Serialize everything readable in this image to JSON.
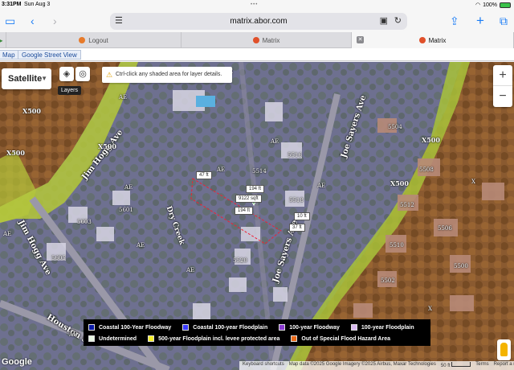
{
  "status": {
    "time": "3:31PM",
    "date": "Sun Aug 3",
    "battery": "100%"
  },
  "toolbar": {
    "url": "matrix.abor.com"
  },
  "tabs": [
    {
      "label": "Logout"
    },
    {
      "label": "Matrix"
    },
    {
      "label": "Matrix"
    }
  ],
  "map_types": {
    "map": "Map",
    "street_view": "Google Street View"
  },
  "map": {
    "type_select": "Satellite",
    "layers_tooltip": "Layers",
    "hint": "Ctrl-click any shaded area for layer details.",
    "zoom_in": "+",
    "zoom_out": "−",
    "streets": {
      "jim_hogg_1": "Jim Hogg Ave",
      "jim_hogg_2": "Jim Hogg Ave",
      "joe_sayers_1": "Joe Sayers Ave",
      "joe_sayers_2": "Joe Sayers Ave",
      "dry_creek": "Dry Creek",
      "houston": "Houston St"
    },
    "zones": {
      "x500": "X500",
      "ae": "AE",
      "x": "X"
    },
    "measurements": {
      "top": "47 ft",
      "right_top": "194 ft",
      "area": "9122 sqft",
      "bottom": "194 ft",
      "side_a": "10 ft",
      "side_b": "37 ft"
    },
    "house_numbers": [
      "5504",
      "5508",
      "5512",
      "5506",
      "5510",
      "5514",
      "5516",
      "5518",
      "5520",
      "5601",
      "5603",
      "5605",
      "5500",
      "5502"
    ],
    "attribution": {
      "keyboard": "Keyboard shortcuts",
      "data": "Map data ©2025 Google Imagery ©2025 Airbus, Maxar Technologies",
      "scale": "50 ft",
      "terms": "Terms",
      "report": "Report a map error"
    },
    "google": "Google"
  },
  "legend": [
    [
      {
        "label": "Coastal 100-Year Floodway",
        "color": "#0a1aa8"
      },
      {
        "label": "Coastal 100-year Floodplain",
        "color": "#3a3aff"
      },
      {
        "label": "100-year Floodway",
        "color": "#8a3ad0"
      },
      {
        "label": "100-year Floodplain",
        "color": "#d7b8ef"
      }
    ],
    [
      {
        "label": "Undetermined",
        "color": "#e8f6e2"
      },
      {
        "label": "500-year Floodplain incl. levee protected area",
        "color": "#f5ef2a"
      },
      {
        "label": "Out of Special Flood Hazard Area",
        "color": "#e96a1a"
      }
    ]
  ]
}
